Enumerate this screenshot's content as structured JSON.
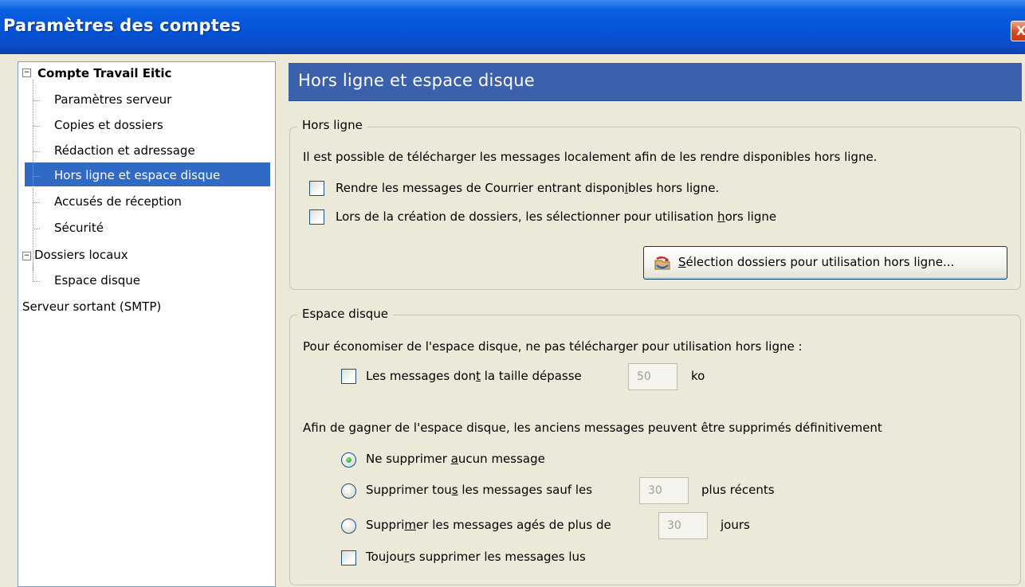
{
  "window": {
    "title": "Paramètres des comptes",
    "close_label": "X"
  },
  "tree": {
    "items": [
      {
        "label": "Compte Travail Eitic",
        "expander": "−"
      },
      {
        "label": "Paramètres serveur"
      },
      {
        "label": "Copies et dossiers"
      },
      {
        "label": "Rédaction et adressage"
      },
      {
        "label": "Hors ligne et espace disque",
        "selected": true
      },
      {
        "label": "Accusés de réception"
      },
      {
        "label": "Sécurité"
      },
      {
        "label": "Dossiers locaux",
        "expander": "−"
      },
      {
        "label": "Espace disque"
      },
      {
        "label": "Serveur sortant (SMTP)"
      }
    ]
  },
  "page": {
    "title": "Hors ligne et espace disque"
  },
  "offline": {
    "legend": "Hors ligne",
    "description": "Il est possible de télécharger les messages localement afin de les rendre disponibles hors ligne.",
    "options": [
      {
        "pre": "Rendre les messages de Courrier entrant dispon",
        "key": "i",
        "post": "bles hors ligne.",
        "checked": false
      },
      {
        "pre": "Lors de la création de dossiers, les sélectionner pour utilisation ",
        "key": "h",
        "post": "ors ligne",
        "checked": false
      }
    ],
    "button": {
      "key": "S",
      "post": "élection dossiers pour utilisation hors ligne...",
      "icon": "folder-sync-icon"
    }
  },
  "disk": {
    "legend": "Espace disque",
    "description": "Pour économiser de l'espace disque, ne pas télécharger pour utilisation hors ligne :",
    "size_option": {
      "pre": "Les messages don",
      "key": "t",
      "post": " la taille dépasse",
      "value": "50",
      "unit": "ko",
      "checked": false
    },
    "cleanup_description": "Afin de gagner de l'espace disque, les anciens messages peuvent être supprimés définitivement",
    "radio_none": {
      "pre": "Ne supprimer ",
      "key": "a",
      "post": "ucun message",
      "selected": true
    },
    "radio_keep": {
      "pre": "Supprimer tou",
      "key": "s",
      "post": " les messages sauf les",
      "value": "30",
      "suffix": "plus récents",
      "selected": false
    },
    "radio_age": {
      "pre": "Suppri",
      "key": "m",
      "post": "er les messages agés de plus de",
      "value": "30",
      "suffix": "jours",
      "selected": false
    },
    "always_delete_read": {
      "pre": "Toujou",
      "key": "r",
      "post": "s supprimer les messages lus",
      "checked": false
    }
  },
  "colors": {
    "titlebar": "#0454d8",
    "header": "#3b61ac",
    "selection": "#316ac5",
    "dialog_bg": "#ece9d8"
  }
}
